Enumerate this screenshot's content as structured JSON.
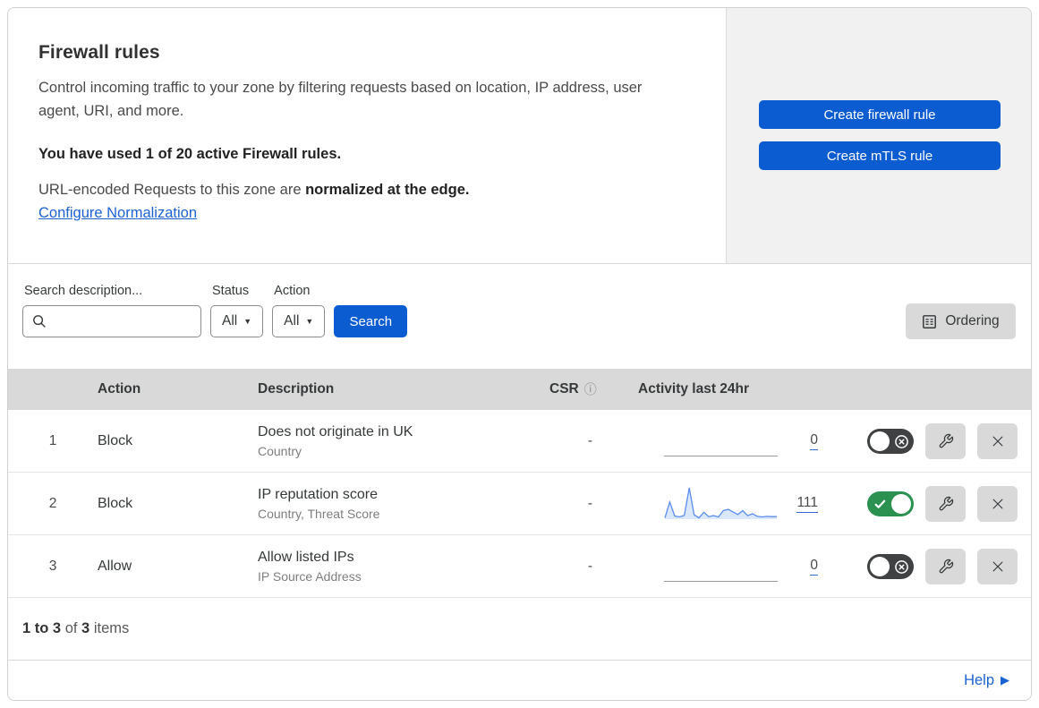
{
  "colors": {
    "accent_blue": "#0b5cd1",
    "link_blue": "#1b62d2",
    "toggle_on_green": "#2b9150",
    "toggle_off_gray": "#3f4142",
    "table_header_gray": "#d9d9d9",
    "panel_gray": "#f1f1f1",
    "spark_line_blue": "#5b8def",
    "spark_fill_blue": "#dbe7fb"
  },
  "icons": {
    "info": "ⓘ",
    "caret": "▼",
    "help_arrow": "▶"
  },
  "hero": {
    "title": "Firewall rules",
    "description": "Control incoming traffic to your zone by filtering requests based on location, IP address, user agent, URI, and more.",
    "usage": "You have used 1 of 20 active Firewall rules.",
    "normalization_prefix": "URL-encoded Requests to this zone are ",
    "normalization_bold": "normalized at the edge.",
    "normalization_link": "Configure Normalization",
    "create_firewall_button": "Create firewall rule",
    "create_mtls_button": "Create mTLS rule"
  },
  "filters": {
    "search_label": "Search description...",
    "search_value": "",
    "status_label": "Status",
    "status_value": "All",
    "action_label": "Action",
    "action_value": "All",
    "search_button": "Search",
    "ordering_button": "Ordering"
  },
  "table": {
    "columns": {
      "action": "Action",
      "description": "Description",
      "csr": "CSR",
      "activity": "Activity last 24hr"
    },
    "rows": [
      {
        "index": "1",
        "action": "Block",
        "description": "Does not originate in UK",
        "fields": "Country",
        "csr": "-",
        "activity_count": "0",
        "enabled": false,
        "sparkline": []
      },
      {
        "index": "2",
        "action": "Block",
        "description": "IP reputation score",
        "fields": "Country, Threat Score",
        "csr": "-",
        "activity_count": "111",
        "enabled": true,
        "sparkline": [
          4,
          55,
          10,
          7,
          12,
          100,
          14,
          4,
          22,
          8,
          11,
          7,
          27,
          31,
          23,
          15,
          27,
          11,
          17,
          9,
          7,
          9,
          8,
          8
        ]
      },
      {
        "index": "3",
        "action": "Allow",
        "description": "Allow listed IPs",
        "fields": "IP Source Address",
        "csr": "-",
        "activity_count": "0",
        "enabled": false,
        "sparkline": []
      }
    ]
  },
  "footer": {
    "range": "1 to 3",
    "of": " of ",
    "total": "3",
    "items": " items",
    "help": "Help"
  }
}
